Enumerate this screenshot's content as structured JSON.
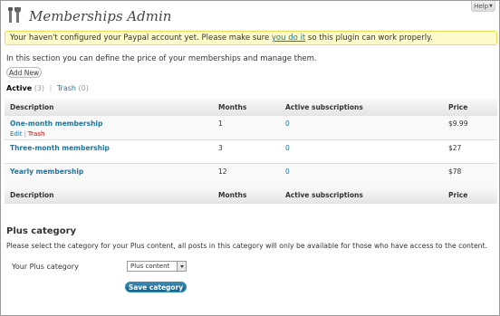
{
  "header": {
    "title": "Memberships Admin",
    "logo_icon": "tools-icon",
    "help_label": "Help"
  },
  "notice": {
    "text_before": "Your haven't configured your Paypal account yet. Please make sure ",
    "link_text": "you do it",
    "text_after": " so this plugin can work properly."
  },
  "intro": "In this section you can define the price of your memberships and manage them.",
  "add_new_label": "Add New",
  "filters": {
    "active_label": "Active",
    "active_count": "(3)",
    "separator": "|",
    "trash_label": "Trash",
    "trash_count": "(0)"
  },
  "table": {
    "columns": [
      "Description",
      "Months",
      "Active subscriptions",
      "Price"
    ],
    "rows": [
      {
        "name": "One-month membership",
        "months": "1",
        "active": "0",
        "price": "$9.99",
        "edit": "Edit",
        "sep": "|",
        "trash": "Trash"
      },
      {
        "name": "Three-month membership",
        "months": "3",
        "active": "0",
        "price": "$27"
      },
      {
        "name": "Yearly membership",
        "months": "12",
        "active": "0",
        "price": "$78"
      }
    ]
  },
  "plus": {
    "title": "Plus category",
    "description": "Please select the category for your Plus content, all posts in this category will only be available for those who have access to the content.",
    "field_label": "Your Plus category",
    "selected": "Plus content",
    "save_label": "Save category"
  },
  "colors": {
    "link": "#21759b",
    "trash": "#bc0b0b",
    "notice_bg": "#fffbcc",
    "primary_button": "#21759b"
  }
}
